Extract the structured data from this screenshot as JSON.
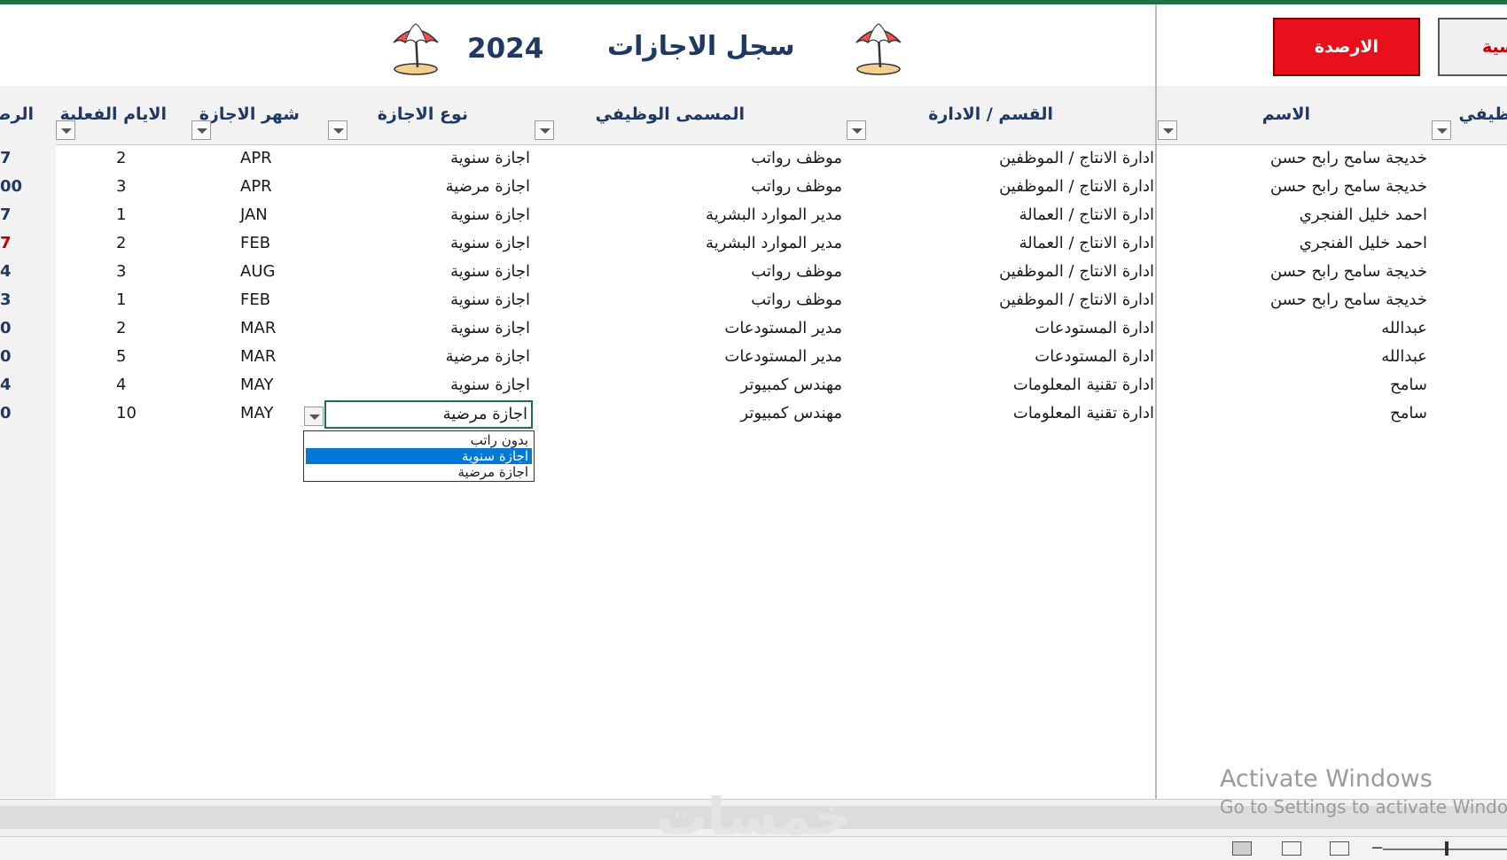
{
  "title": {
    "main": "سجل الاجازات",
    "year": "2024"
  },
  "buttons": {
    "balances": "الارصدة",
    "main_partial": "سية"
  },
  "icons": {
    "umbrella": "beach-umbrella-icon",
    "filter": "filter-dropdown-icon"
  },
  "columns": {
    "name": "الاسم",
    "job_partial": "ظيفي",
    "department": "القسم / الادارة",
    "job_title": "المسمى الوظيفي",
    "leave_type": "نوع الاجازة",
    "leave_month": "شهر الاجازة",
    "actual_days": "الايام الفعلية",
    "balance_partial": "الرصـ"
  },
  "rows": [
    {
      "name": "خديجة سامح رابح حسن",
      "department": "ادارة الانتاج / الموظفين",
      "job_title": "موظف رواتب",
      "leave_type": "اجازة سنوية",
      "month": "APR",
      "days": "2",
      "balance": "7"
    },
    {
      "name": "خديجة سامح رابح حسن",
      "department": "ادارة الانتاج / الموظفين",
      "job_title": "موظف رواتب",
      "leave_type": "اجازة مرضية",
      "month": "APR",
      "days": "3",
      "balance": "00"
    },
    {
      "name": "احمد خليل الفنجري",
      "department": "ادارة الانتاج / العمالة",
      "job_title": "مدير الموارد البشرية",
      "leave_type": "اجازة سنوية",
      "month": "JAN",
      "days": "1",
      "balance": "7"
    },
    {
      "name": "احمد خليل الفنجري",
      "department": "ادارة الانتاج / العمالة",
      "job_title": "مدير الموارد البشرية",
      "leave_type": "اجازة سنوية",
      "month": "FEB",
      "days": "2",
      "balance": "7",
      "negative": true
    },
    {
      "name": "خديجة سامح رابح حسن",
      "department": "ادارة الانتاج / الموظفين",
      "job_title": "موظف رواتب",
      "leave_type": "اجازة سنوية",
      "month": "AUG",
      "days": "3",
      "balance": "4"
    },
    {
      "name": "خديجة سامح رابح حسن",
      "department": "ادارة الانتاج / الموظفين",
      "job_title": "موظف رواتب",
      "leave_type": "اجازة سنوية",
      "month": "FEB",
      "days": "1",
      "balance": "3"
    },
    {
      "name": "عبدالله",
      "department": "ادارة المستودعات",
      "job_title": "مدير المستودعات",
      "leave_type": "اجازة سنوية",
      "month": "MAR",
      "days": "2",
      "balance": "0"
    },
    {
      "name": "عبدالله",
      "department": "ادارة المستودعات",
      "job_title": "مدير المستودعات",
      "leave_type": "اجازة مرضية",
      "month": "MAR",
      "days": "5",
      "balance": "0"
    },
    {
      "name": "سامح",
      "department": "ادارة تقنية المعلومات",
      "job_title": "مهندس كمبيوتر",
      "leave_type": "اجازة سنوية",
      "month": "MAY",
      "days": "4",
      "balance": "4"
    },
    {
      "name": "سامح",
      "department": "ادارة تقنية المعلومات",
      "job_title": "مهندس كمبيوتر",
      "leave_type": "اجازة مرضية",
      "month": "MAY",
      "days": "10",
      "balance": "0"
    }
  ],
  "dropdown": {
    "options": [
      "بدون راتب",
      "اجازة سنوية",
      "اجازة مرضية"
    ],
    "highlighted": "اجازة سنوية"
  },
  "activation": {
    "line1": "Activate Windows",
    "line2": "Go to Settings to activate Windows."
  },
  "watermark": "خمسات",
  "colors": {
    "accent": "#1f3864",
    "excel_green": "#1e7145",
    "button_red": "#e8101a",
    "negative": "#c00000",
    "selection": "#0078d7"
  }
}
